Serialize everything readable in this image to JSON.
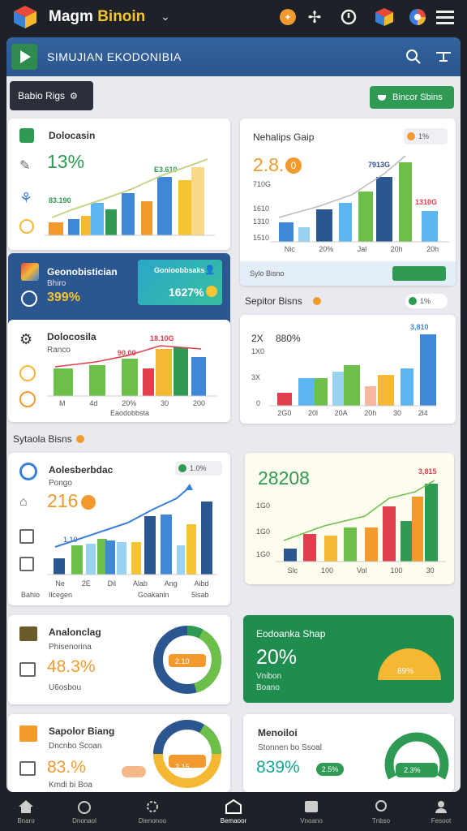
{
  "app": {
    "title_main": "Magm ",
    "title_highlight": "Binoin",
    "window_title": "SIMUJIAN EKODONIBIA"
  },
  "toolbar": {
    "tab_label": "Babio Rigs",
    "action_label": "Bincor Sbins"
  },
  "cards": {
    "c1": {
      "title": "Dolocasin",
      "value": "13%",
      "bar_label_a": "E3.610",
      "bar_label_b": "83.190"
    },
    "c2": {
      "title": "Nehalips Gaip",
      "value": "2.8.",
      "coin": "0",
      "axis_hint": "710G",
      "bar_label_a": "7913G",
      "bar_label_b": "1310G",
      "pill": "1%",
      "y_ticks": [
        "1610",
        "1310",
        "1510"
      ],
      "x_ticks": [
        "Nic",
        "20%",
        "Jal",
        "20h",
        "20h"
      ]
    },
    "c3": {
      "title": "Geonobistician",
      "sub": "Bhiro",
      "value": "399%",
      "mini_title": "Gonioobbsaks",
      "mini_value": "1627%"
    },
    "c4_badge": "Sylo Bisno",
    "c4_section": "Sepitor Bisns",
    "c4_pill": "1%",
    "c5": {
      "title": "Dolocosila",
      "sub": "Ranco",
      "bar_label_a": "18.10G",
      "bar_label_b": "90.00",
      "x_ticks": [
        "M",
        "4d",
        "20%",
        "30",
        "200"
      ],
      "footer": "Eaodobbsta"
    },
    "c6": {
      "title": "2X",
      "value": "880%",
      "bar_label": "3,810",
      "y_ticks": [
        "1X0",
        "3X",
        "0"
      ],
      "x_ticks": [
        "2G0",
        "20l",
        "20A",
        "20h",
        "30",
        "2l4"
      ]
    },
    "section2": "Sytaola Bisns",
    "c7": {
      "title": "Aolesberbdac",
      "sub": "Pongo",
      "value": "216",
      "pill": "1.0%",
      "bar_label_a": "1.10",
      "x_ticks": [
        "Ne",
        "2E",
        "Dil",
        "Alab",
        "Ang",
        "Aibd"
      ],
      "footer_a": "Bahio",
      "footer_b": "Ilcegen",
      "footer_c": "Goakanin",
      "footer_d": "5lsab"
    },
    "c8": {
      "value": "28208",
      "bar_label": "3,815",
      "y_ticks": [
        "1G0",
        "1G0",
        "1G0"
      ],
      "x_ticks": [
        "Slc",
        "100",
        "Vol",
        "100",
        "30"
      ]
    },
    "c9": {
      "title": "Analonclag",
      "sub": "Phisenorina",
      "value": "48.3%",
      "foot": "U6osbou",
      "donut_label": "2.10"
    },
    "c10": {
      "title": "Eodoanka Shap",
      "value": "20%",
      "sub1": "Vnibon",
      "sub2": "Boano",
      "gauge_label": "89%"
    },
    "c11": {
      "title": "Sapolor Biang",
      "sub1": "Dncnbo Scoan",
      "sub2": "Kmdi bi Boa",
      "value": "83.%",
      "donut_label": "2.15"
    },
    "c12": {
      "title": "Menoiloi",
      "sub": "Stonnen bo Ssoal",
      "value": "839%",
      "pill": "2.5%",
      "gauge_label": "2.3%"
    }
  },
  "nav": [
    "Bnaro",
    "Dnonaol",
    "Dienonoo",
    "Bemaoor",
    "Vnoano",
    "Tnbso",
    "Fesoot"
  ],
  "colors": {
    "accent_green": "#2e9a53",
    "header_blue": "#2f5f99",
    "bar_blue": "#3f88d8",
    "bar_orange": "#f29a2e",
    "bar_red": "#e0404e"
  }
}
